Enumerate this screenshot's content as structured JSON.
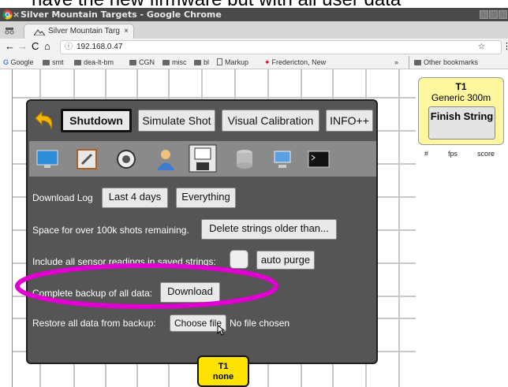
{
  "caption": "have the new firmware but with all user data",
  "window": {
    "title": "Silver Mountain Targets - Google Chrome"
  },
  "tab": {
    "label": "Silver Mountain Targ",
    "close": "×"
  },
  "toolbar": {
    "url": "192.168.0.47",
    "star": "☆",
    "menu": "⋮"
  },
  "bookmarks": {
    "items": [
      "Google",
      "smt",
      "dea-lt-bm",
      "CGN",
      "misc",
      "bl",
      "Markup",
      "Fredericton, New"
    ],
    "overflow": "»",
    "other": "Other bookmarks"
  },
  "panel": {
    "buttons": {
      "shutdown": "Shutdown",
      "simulate": "Simulate Shot",
      "calibration": "Visual Calibration",
      "info": "INFO++"
    },
    "icons": [
      "monitor-icon",
      "settings-screen-icon",
      "wrench-icon",
      "user-icon",
      "save-disk-icon",
      "database-icon",
      "network-icon",
      "terminal-icon"
    ],
    "download_log": {
      "label": "Download Log",
      "btn1": "Last 4 days",
      "btn2": "Everything"
    },
    "space": {
      "label": "Space for over 100k shots remaining.",
      "btn": "Delete strings older than..."
    },
    "sensors": {
      "label": "Include all sensor readings in saved strings:",
      "btn": "auto purge"
    },
    "backup": {
      "label": "Complete backup of all data:",
      "btn": "Download"
    },
    "restore": {
      "label": "Restore all data from backup:",
      "btn": "Choose file",
      "status": "No file chosen"
    }
  },
  "stats": {
    "target": "T1",
    "distance": "Generic 300m",
    "finish": "Finish String",
    "columns": [
      "#",
      "fps",
      "score"
    ]
  },
  "shot_badge": {
    "target": "T1",
    "value": "none"
  },
  "colors": {
    "highlight": "#e000d0",
    "badge": "#ffe300",
    "card": "#fff7a0",
    "panel": "#555555"
  }
}
